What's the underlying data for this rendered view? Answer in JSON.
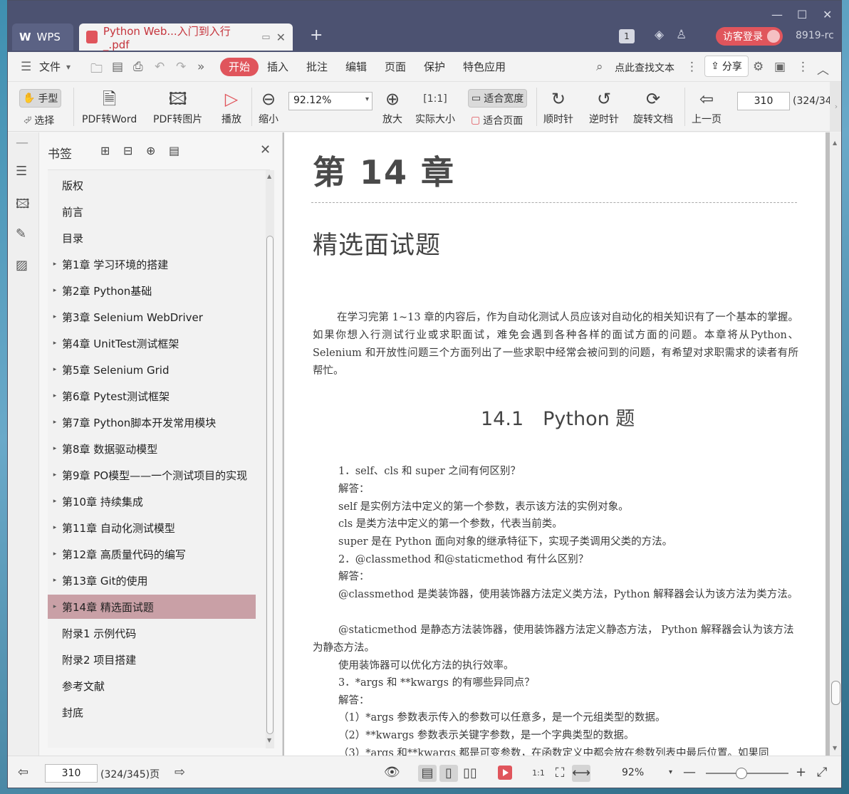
{
  "titlebar": {
    "wps_tab": "WPS",
    "doc_tab": "Python Web...入门到入行_.pdf",
    "badge_count": "1",
    "login_label": "访客登录",
    "version": "8919-rc"
  },
  "menu": {
    "file": "文件",
    "items": [
      "开始",
      "插入",
      "批注",
      "编辑",
      "页面",
      "保护",
      "特色应用"
    ],
    "search": "点此查找文本",
    "share": "分享"
  },
  "toolbar": {
    "hand": "手型",
    "select": "选择",
    "pdf_to_word": "PDF转Word",
    "pdf_to_image": "PDF转图片",
    "play": "播放",
    "zoom_out": "缩小",
    "zoom_value": "92.12%",
    "zoom_in": "放大",
    "actual_size": "实际大小",
    "fit_width": "适合宽度",
    "fit_page": "适合页面",
    "rotate_cw": "顺时针",
    "rotate_ccw": "逆时针",
    "rotate_doc": "旋转文档",
    "prev_page": "上一页",
    "page_value": "310",
    "page_total": "(324/34"
  },
  "bookmarks": {
    "title": "书签",
    "items": [
      {
        "label": "版权",
        "expandable": false
      },
      {
        "label": "前言",
        "expandable": false
      },
      {
        "label": "目录",
        "expandable": false
      },
      {
        "label": "第1章 学习环境的搭建",
        "expandable": true
      },
      {
        "label": "第2章 Python基础",
        "expandable": true
      },
      {
        "label": "第3章 Selenium WebDriver",
        "expandable": true
      },
      {
        "label": "第4章 UnitTest测试框架",
        "expandable": true
      },
      {
        "label": "第5章 Selenium Grid",
        "expandable": true
      },
      {
        "label": "第6章 Pytest测试框架",
        "expandable": true
      },
      {
        "label": "第7章 Python脚本开发常用模块",
        "expandable": true
      },
      {
        "label": "第8章 数据驱动模型",
        "expandable": true
      },
      {
        "label": "第9章 PO模型——一个测试项目的实现",
        "expandable": true
      },
      {
        "label": "第10章 持续集成",
        "expandable": true
      },
      {
        "label": "第11章 自动化测试模型",
        "expandable": true
      },
      {
        "label": "第12章 高质量代码的编写",
        "expandable": true
      },
      {
        "label": "第13章 Git的使用",
        "expandable": true
      },
      {
        "label": "第14章 精选面试题",
        "expandable": true,
        "selected": true
      },
      {
        "label": "附录1 示例代码",
        "expandable": false
      },
      {
        "label": "附录2 项目搭建",
        "expandable": false
      },
      {
        "label": "参考文献",
        "expandable": false
      },
      {
        "label": "封底",
        "expandable": false
      }
    ]
  },
  "document": {
    "chapter": "第 14 章",
    "chapter_title": "精选面试题",
    "intro": "在学习完第 1~13 章的内容后，作为自动化测试人员应该对自动化的相关知识有了一个基本的掌握。如果你想入行测试行业或求职面试，难免会遇到各种各样的面试方面的问题。本章将从Python、Selenium 和开放性问题三个方面列出了一些求职中经常会被问到的问题，有希望对求职需求的读者有所帮忙。",
    "section": "14.1　Python 题",
    "lines": [
      "1．self、cls 和 super 之间有何区别？",
      "解答：",
      "self 是实例方法中定义的第一个参数，表示该方法的实例对象。",
      "cls 是类方法中定义的第一个参数，代表当前类。",
      "super 是在 Python 面向对象的继承特征下，实现子类调用父类的方法。",
      "2．@classmethod 和@staticmethod 有什么区别？",
      "解答："
    ],
    "para_classmethod": "@classmethod 是类装饰器，使用装饰器方法定义类方法，Python 解释器会认为该方法为类方法。",
    "para_staticmethod": "@staticmethod 是静态方法装饰器，使用装饰器方法定义静态方法， Python 解释器会认为该方法为静态方法。",
    "lines2": [
      "使用装饰器可以优化方法的执行效率。",
      "3．*args 和 **kwargs 的有哪些异同点？",
      "解答：",
      "（1）*args 参数表示传入的参数可以任意多，是一个元组类型的数据。",
      "（2）**kwargs 参数表示关键字参数，是一个字典类型的数据。",
      "（3）*args 和**kwargs 都是可变参数，在函数定义中都会放在参数列表中最后位置。如果同"
    ]
  },
  "status": {
    "page_value": "310",
    "page_info": "(324/345)页",
    "zoom": "92%"
  }
}
